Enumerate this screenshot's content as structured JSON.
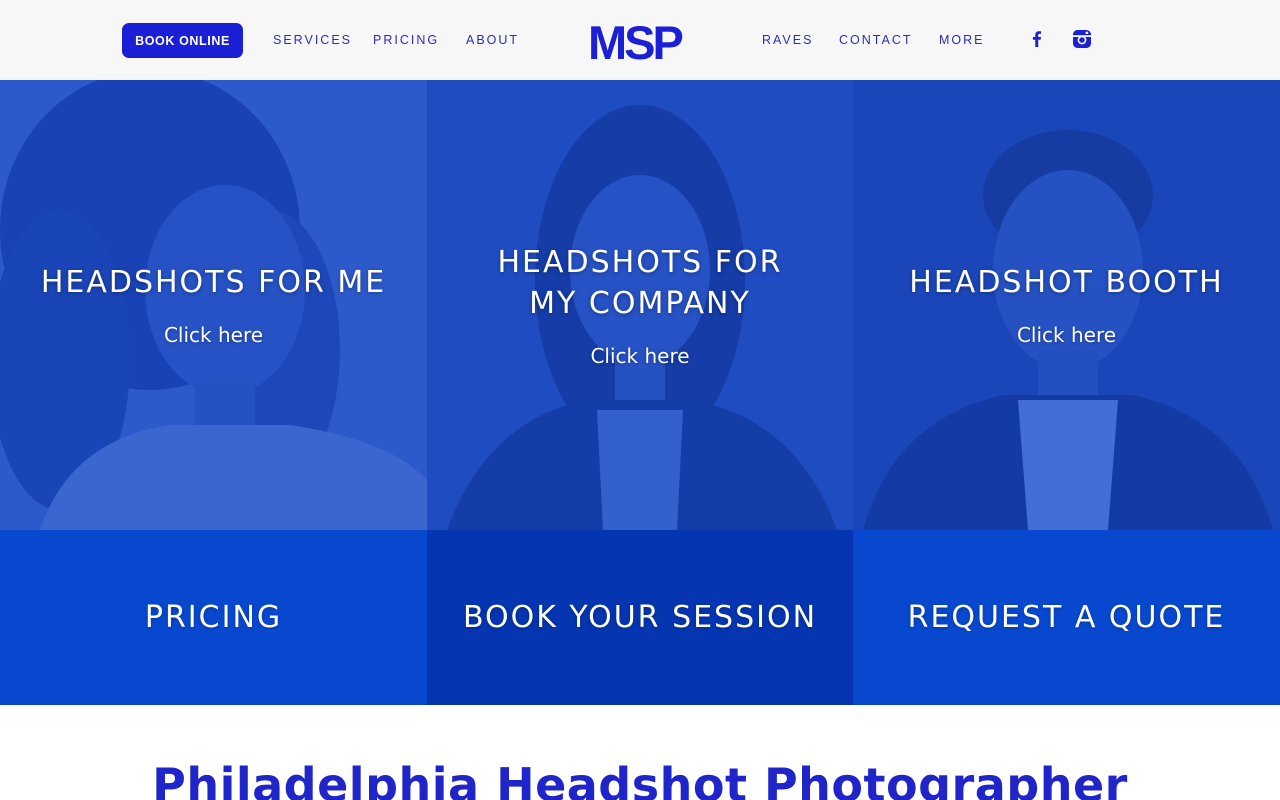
{
  "header": {
    "book_button": "BOOK ONLINE",
    "nav_left": [
      "SERVICES",
      "PRICING",
      "ABOUT"
    ],
    "logo_text": "MSP",
    "nav_right": [
      "RAVES",
      "CONTACT",
      "MORE"
    ],
    "social_icons": [
      "facebook-icon",
      "instagram-icon"
    ]
  },
  "tiles": [
    {
      "title": "HEADSHOTS FOR ME",
      "cta": "Click here"
    },
    {
      "title": "HEADSHOTS FOR\nMY COMPANY",
      "cta": "Click here"
    },
    {
      "title": "HEADSHOT BOOTH",
      "cta": "Click here"
    }
  ],
  "blocks": [
    {
      "label": "PRICING"
    },
    {
      "label": "BOOK YOUR SESSION"
    },
    {
      "label": "REQUEST A QUOTE"
    }
  ],
  "main": {
    "heading": "Philadelphia Headshot Photographer"
  },
  "colors": {
    "brand_blue": "#1b1fd6",
    "nav_text": "#2a2fb5",
    "block_primary": "#0848cf",
    "block_dark": "#0535b0",
    "heading": "#1f25c8"
  }
}
